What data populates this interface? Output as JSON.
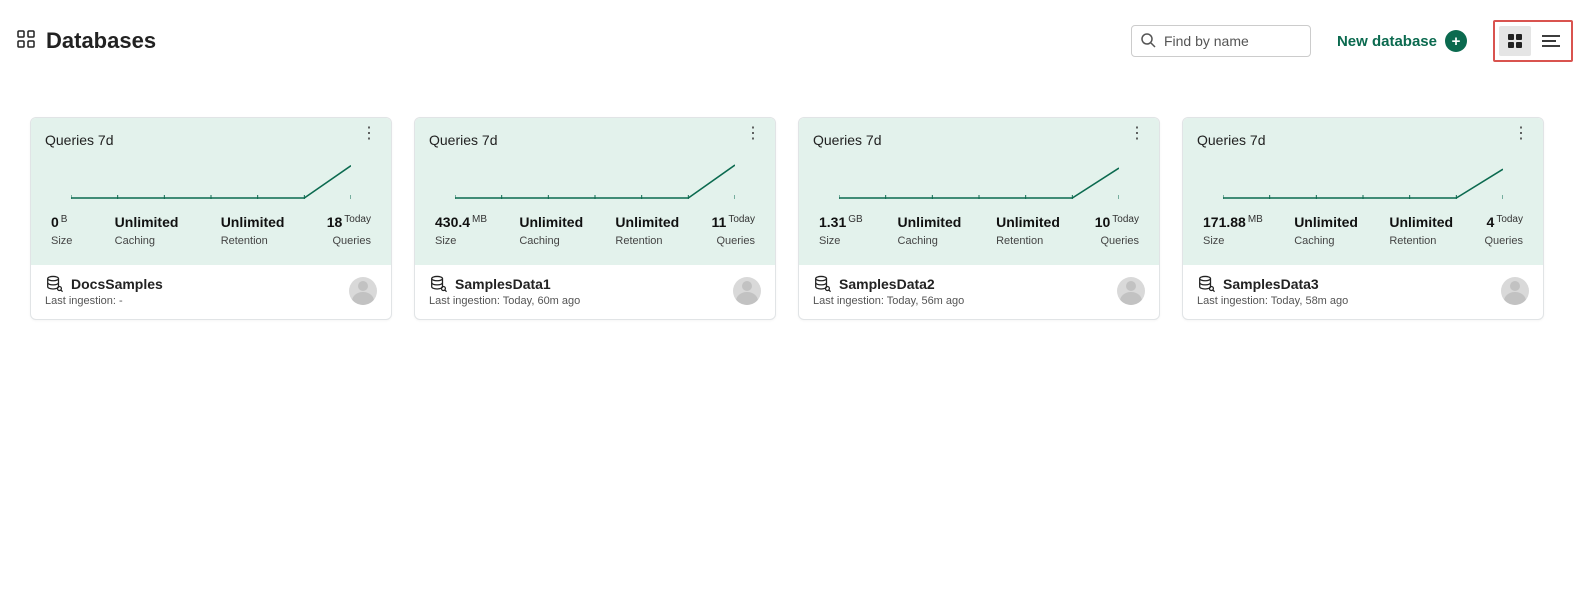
{
  "header": {
    "title": "Databases",
    "search_placeholder": "Find by name",
    "new_db_label": "New database"
  },
  "card_common": {
    "queries_label": "Queries 7d",
    "size_label": "Size",
    "caching_label": "Caching",
    "retention_label": "Retention",
    "queries_today_label": "Queries",
    "ingestion_prefix": "Last ingestion: "
  },
  "cards": [
    {
      "name": "DocsSamples",
      "size_value": "0",
      "size_unit": "B",
      "caching": "Unlimited",
      "retention": "Unlimited",
      "queries_today": "18",
      "today_unit": "Today",
      "last_ingestion": "-"
    },
    {
      "name": "SamplesData1",
      "size_value": "430.4",
      "size_unit": "MB",
      "caching": "Unlimited",
      "retention": "Unlimited",
      "queries_today": "11",
      "today_unit": "Today",
      "last_ingestion": "Today, 60m ago"
    },
    {
      "name": "SamplesData2",
      "size_value": "1.31",
      "size_unit": "GB",
      "caching": "Unlimited",
      "retention": "Unlimited",
      "queries_today": "10",
      "today_unit": "Today",
      "last_ingestion": "Today, 56m ago"
    },
    {
      "name": "SamplesData3",
      "size_value": "171.88",
      "size_unit": "MB",
      "caching": "Unlimited",
      "retention": "Unlimited",
      "queries_today": "4",
      "today_unit": "Today",
      "last_ingestion": "Today, 58m ago"
    }
  ],
  "chart_data": [
    {
      "type": "line",
      "x": [
        0,
        1,
        2,
        3,
        4,
        5,
        6
      ],
      "values": [
        0,
        0,
        0,
        0,
        0,
        0,
        18
      ],
      "ylim": [
        0,
        20
      ]
    },
    {
      "type": "line",
      "x": [
        0,
        1,
        2,
        3,
        4,
        5,
        6
      ],
      "values": [
        0,
        0,
        0,
        0,
        0,
        0,
        11
      ],
      "ylim": [
        0,
        12
      ]
    },
    {
      "type": "line",
      "x": [
        0,
        1,
        2,
        3,
        4,
        5,
        6
      ],
      "values": [
        0,
        0,
        0,
        0,
        0,
        0,
        10
      ],
      "ylim": [
        0,
        12
      ]
    },
    {
      "type": "line",
      "x": [
        0,
        1,
        2,
        3,
        4,
        5,
        6
      ],
      "values": [
        0,
        0,
        0,
        0,
        0,
        0,
        4
      ],
      "ylim": [
        0,
        5
      ]
    }
  ]
}
